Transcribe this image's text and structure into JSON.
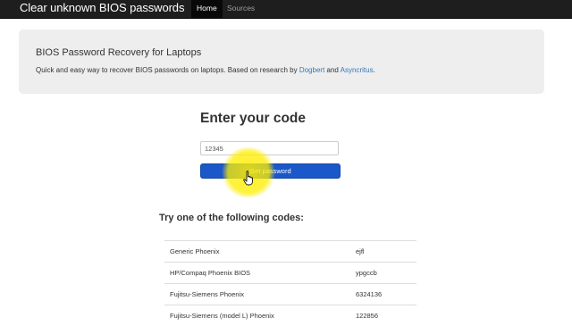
{
  "navbar": {
    "brand": "Clear unknown BIOS passwords",
    "items": [
      {
        "label": "Home",
        "active": true
      },
      {
        "label": "Sources",
        "active": false
      }
    ]
  },
  "jumbotron": {
    "title": "BIOS Password Recovery for Laptops",
    "text_prefix": "Quick and easy way to recover BIOS passwords on laptops. Based on research by",
    "link1": "Dogbert",
    "text_and": "and",
    "link2": "Asyncritus",
    "text_suffix": "."
  },
  "form": {
    "heading": "Enter your code",
    "input_value": "12345",
    "button_label": "Get password"
  },
  "examples": {
    "heading": "Try one of the following codes:",
    "rows": [
      {
        "model": "Generic Phoenix",
        "code": "ejfl"
      },
      {
        "model": "HP/Compaq Phoenix BIOS",
        "code": "ypgccb"
      },
      {
        "model": "Fujitsu-Siemens Phoenix",
        "code": "6324136"
      },
      {
        "model": "Fujitsu-Siemens (model L) Phoenix",
        "code": "122856"
      }
    ]
  },
  "colors": {
    "navbar_bg": "#1e1e1e",
    "jumbotron_bg": "#eeeeee",
    "link": "#337ab7",
    "primary_button": "#1a57c9",
    "cursor_highlight": "#ffee00"
  },
  "icons": {
    "cursor": "hand-pointer-icon"
  }
}
